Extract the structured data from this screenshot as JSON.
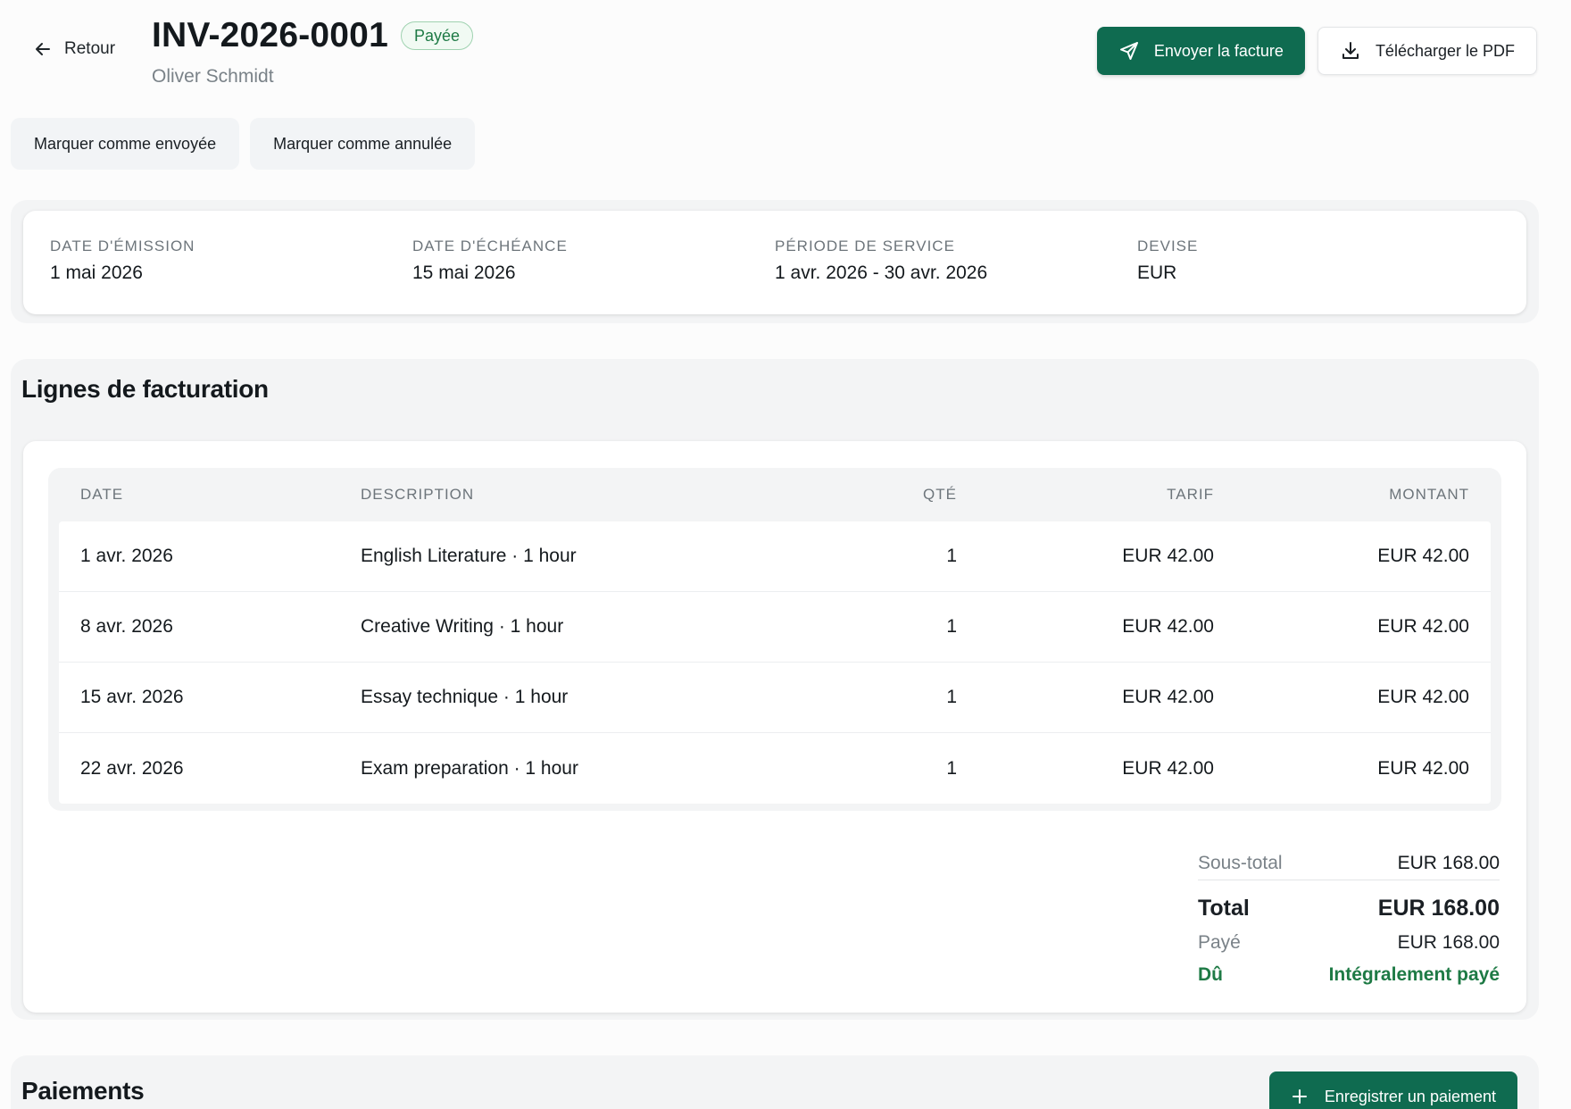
{
  "header": {
    "back_label": "Retour",
    "invoice_number": "INV-2026-0001",
    "status": "Payée",
    "client_name": "Oliver Schmidt",
    "send_label": "Envoyer la facture",
    "download_label": "Télécharger le PDF"
  },
  "actions": {
    "mark_sent": "Marquer comme envoyée",
    "mark_cancelled": "Marquer comme annulée"
  },
  "info": {
    "issue_date_label": "DATE D'ÉMISSION",
    "issue_date": "1 mai 2026",
    "due_date_label": "DATE D'ÉCHÉANCE",
    "due_date": "15 mai 2026",
    "service_period_label": "PÉRIODE DE SERVICE",
    "service_period": "1 avr. 2026 - 30 avr. 2026",
    "currency_label": "DEVISE",
    "currency": "EUR"
  },
  "lines": {
    "title": "Lignes de facturation",
    "headers": {
      "date": "DATE",
      "description": "DESCRIPTION",
      "qty": "QTÉ",
      "rate": "TARIF",
      "amount": "MONTANT"
    },
    "rows": [
      {
        "date": "1 avr. 2026",
        "description": "English Literature · 1 hour",
        "qty": "1",
        "rate": "EUR 42.00",
        "amount": "EUR 42.00"
      },
      {
        "date": "8 avr. 2026",
        "description": "Creative Writing · 1 hour",
        "qty": "1",
        "rate": "EUR 42.00",
        "amount": "EUR 42.00"
      },
      {
        "date": "15 avr. 2026",
        "description": "Essay technique · 1 hour",
        "qty": "1",
        "rate": "EUR 42.00",
        "amount": "EUR 42.00"
      },
      {
        "date": "22 avr. 2026",
        "description": "Exam preparation · 1 hour",
        "qty": "1",
        "rate": "EUR 42.00",
        "amount": "EUR 42.00"
      }
    ]
  },
  "totals": {
    "subtotal_label": "Sous-total",
    "subtotal": "EUR 168.00",
    "total_label": "Total",
    "total": "EUR 168.00",
    "paid_label": "Payé",
    "paid": "EUR 168.00",
    "due_label": "Dû",
    "due": "Intégralement payé"
  },
  "payments": {
    "title": "Paiements",
    "record_label": "Enregistrer un paiement"
  },
  "colors": {
    "primary": "#0f6b50",
    "success": "#1e7a45",
    "muted": "#7a8288"
  },
  "icons": {
    "back": "arrow-left-icon",
    "send": "paper-plane-icon",
    "download": "download-icon",
    "add": "plus-icon"
  }
}
